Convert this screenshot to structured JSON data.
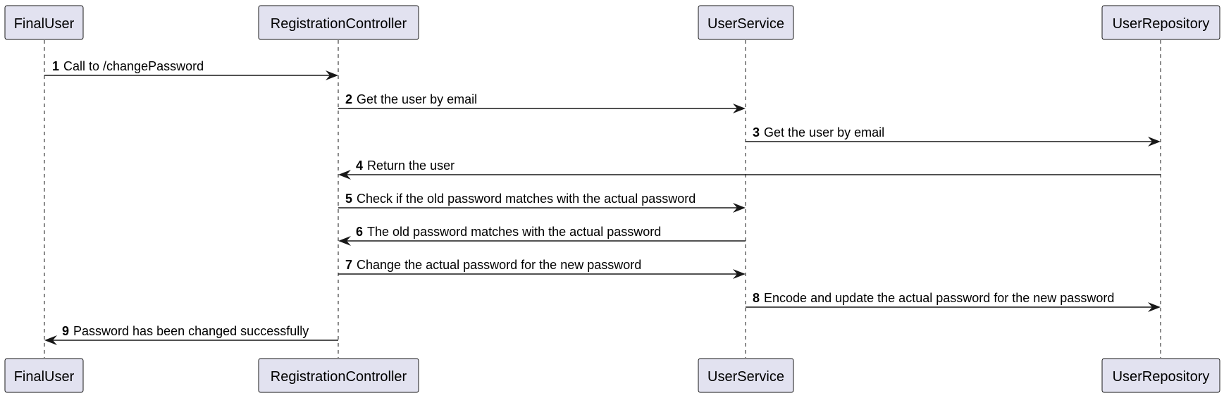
{
  "colors": {
    "participant_fill": "#E2E2F0",
    "line": "#181818",
    "background": "#FFFFFF"
  },
  "participants": [
    {
      "id": "finaluser",
      "label": "FinalUser"
    },
    {
      "id": "registrationcontroller",
      "label": "RegistrationController"
    },
    {
      "id": "userservice",
      "label": "UserService"
    },
    {
      "id": "userrepository",
      "label": "UserRepository"
    }
  ],
  "messages": [
    {
      "number": "1",
      "text": "Call to /changePassword",
      "from": 0,
      "to": 1
    },
    {
      "number": "2",
      "text": "Get the user by email",
      "from": 1,
      "to": 2
    },
    {
      "number": "3",
      "text": "Get the user by email",
      "from": 2,
      "to": 3
    },
    {
      "number": "4",
      "text": "Return the user",
      "from": 3,
      "to": 1
    },
    {
      "number": "5",
      "text": "Check if the old password matches with the actual password",
      "from": 1,
      "to": 2
    },
    {
      "number": "6",
      "text": "The old password matches with the actual password",
      "from": 2,
      "to": 1
    },
    {
      "number": "7",
      "text": "Change the actual password for the new password",
      "from": 1,
      "to": 2
    },
    {
      "number": "8",
      "text": "Encode and update the actual password for the new password",
      "from": 2,
      "to": 3
    },
    {
      "number": "9",
      "text": "Password has been changed successfully",
      "from": 1,
      "to": 0
    }
  ]
}
